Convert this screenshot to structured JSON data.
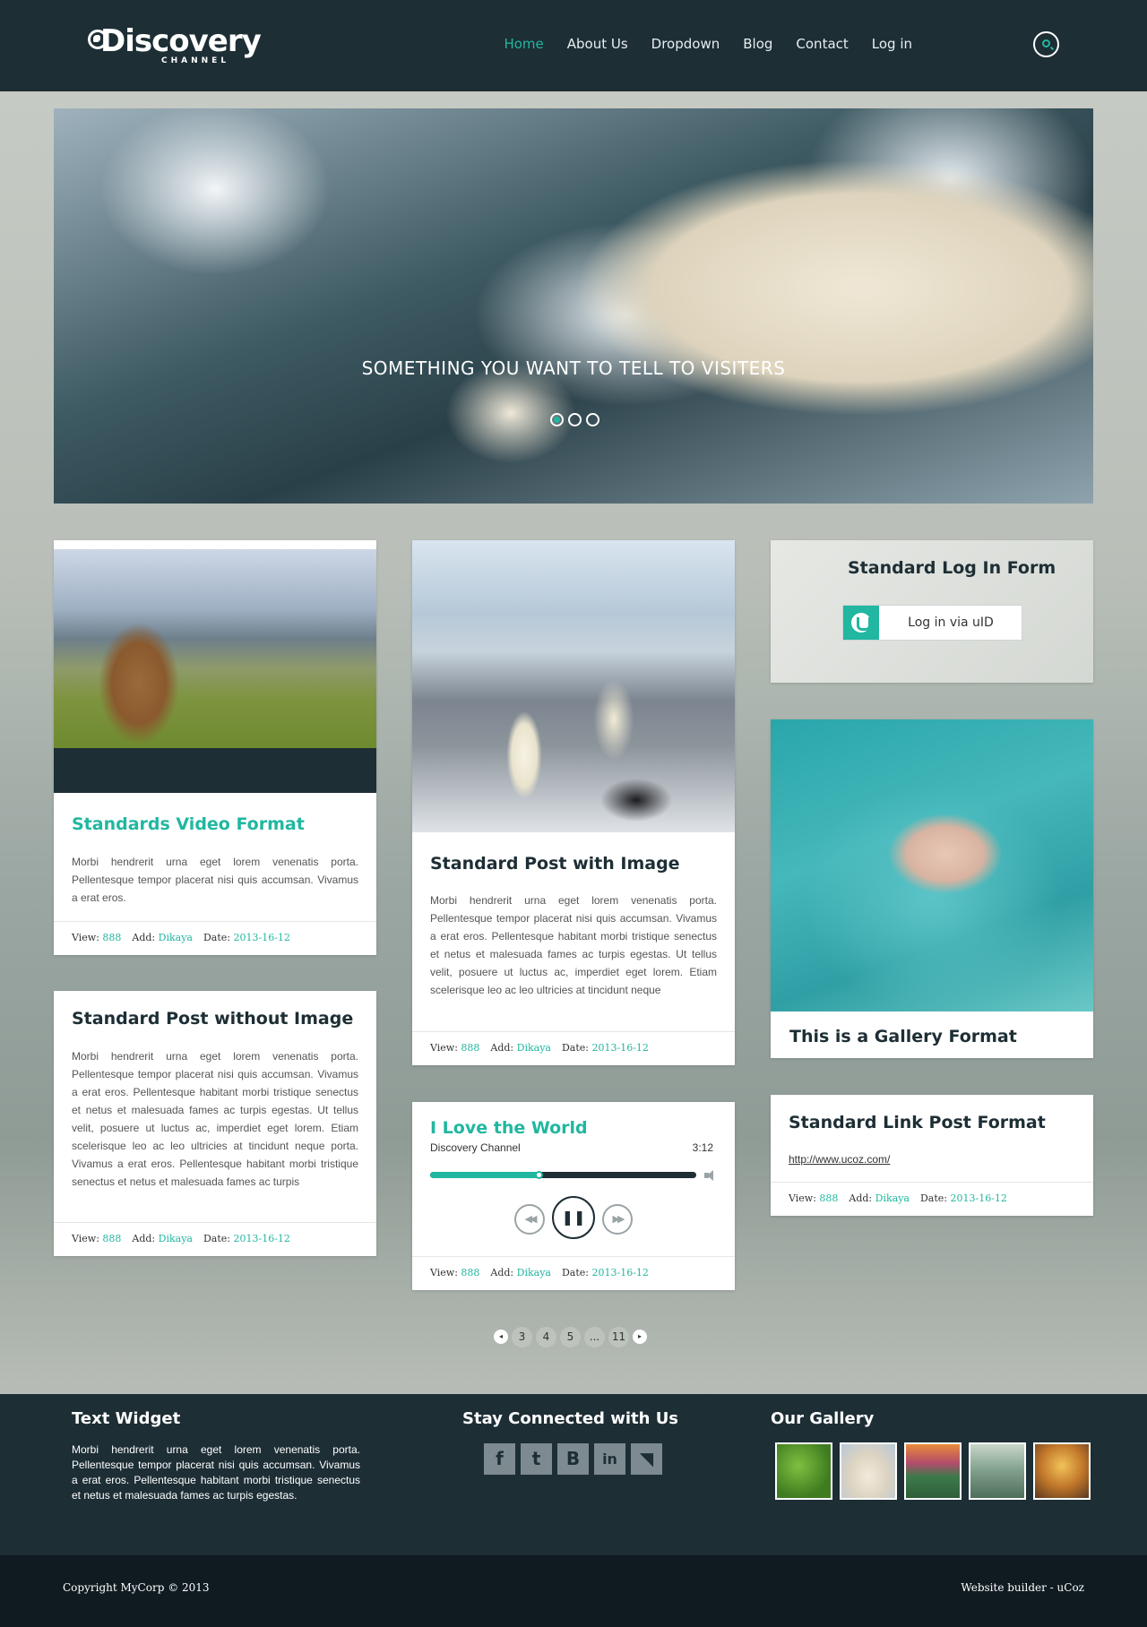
{
  "brand": {
    "logo_text": "Discovery",
    "logo_sub": "CHANNEL"
  },
  "nav": {
    "items": [
      "Home",
      "About Us",
      "Dropdown",
      "Blog",
      "Contact",
      "Log in"
    ],
    "active": "Home",
    "search_icon": "search-icon"
  },
  "slider": {
    "caption": "SOMETHING YOU WANT TO TELL TO VISITERS",
    "dots": 3,
    "active_dot": 1
  },
  "meta_labels": {
    "view": "View:",
    "add": "Add:",
    "date": "Date:"
  },
  "posts": {
    "video": {
      "title": "Standards Video Format",
      "text": "Morbi hendrerit urna eget lorem venenatis porta. Pellentesque tempor placerat nisi quis accumsan. Vivamus a erat eros.",
      "views": "888",
      "author": "Dikaya",
      "date": "2013-16-12"
    },
    "no_image": {
      "title": "Standard Post without Image",
      "text": "Morbi hendrerit urna eget lorem venenatis porta. Pellentesque tempor placerat nisi quis accumsan. Vivamus a erat eros. Pellentesque habitant morbi tristique senectus et netus et malesuada fames ac turpis egestas. Ut tellus velit, posuere ut luctus ac, imperdiet eget lorem. Etiam scelerisque leo ac leo ultricies at tincidunt neque porta. Vivamus a erat eros. Pellentesque habitant morbi tristique senectus et netus et malesuada fames ac turpis",
      "views": "888",
      "author": "Dikaya",
      "date": "2013-16-12"
    },
    "with_image": {
      "title": "Standard Post with Image",
      "text": "Morbi hendrerit urna eget lorem venenatis porta. Pellentesque tempor placerat nisi quis accumsan. Vivamus a erat eros. Pellentesque habitant morbi tristique senectus et netus et malesuada fames ac turpis egestas. Ut tellus velit, posuere ut luctus ac, imperdiet eget lorem. Etiam scelerisque leo ac leo ultricies at tincidunt neque",
      "views": "888",
      "author": "Dikaya",
      "date": "2013-16-12"
    },
    "audio": {
      "title": "I Love the World",
      "artist": "Discovery Channel",
      "duration": "3:12",
      "progress": 0.41,
      "views": "888",
      "author": "Dikaya",
      "date": "2013-16-12"
    },
    "gallery": {
      "title": "This is a Gallery Format"
    },
    "link": {
      "title": "Standard Link Post Format",
      "url": "http://www.ucoz.com/",
      "views": "888",
      "author": "Dikaya",
      "date": "2013-16-12"
    }
  },
  "login": {
    "title": "Standard Log In Form",
    "button": "Log in via uID"
  },
  "pagination": {
    "prev": "◂",
    "pages": [
      "3",
      "4",
      "5",
      "...",
      "11"
    ],
    "next": "▸"
  },
  "footer": {
    "text_widget": {
      "title": "Text Widget",
      "text": "Morbi hendrerit urna eget lorem venenatis porta. Pellentesque tempor placerat nisi quis accumsan. Vivamus a erat eros. Pellentesque habitant morbi tristique senectus et netus et malesuada fames ac turpis egestas."
    },
    "social": {
      "title": "Stay Connected with Us",
      "icons": [
        {
          "name": "facebook-icon",
          "glyph": "f"
        },
        {
          "name": "twitter-icon",
          "glyph": "t"
        },
        {
          "name": "vk-icon",
          "glyph": "B"
        },
        {
          "name": "linkedin-icon",
          "glyph": "in"
        },
        {
          "name": "rss-icon",
          "glyph": "◥"
        }
      ]
    },
    "gallery": {
      "title": "Our Gallery"
    }
  },
  "copyright": {
    "left": "Copyright MyCorp © 2013",
    "right": "Website builder - uCoz"
  },
  "colors": {
    "accent": "#21b7a0",
    "dark": "#1d2e35",
    "darker": "#0f1b21"
  }
}
